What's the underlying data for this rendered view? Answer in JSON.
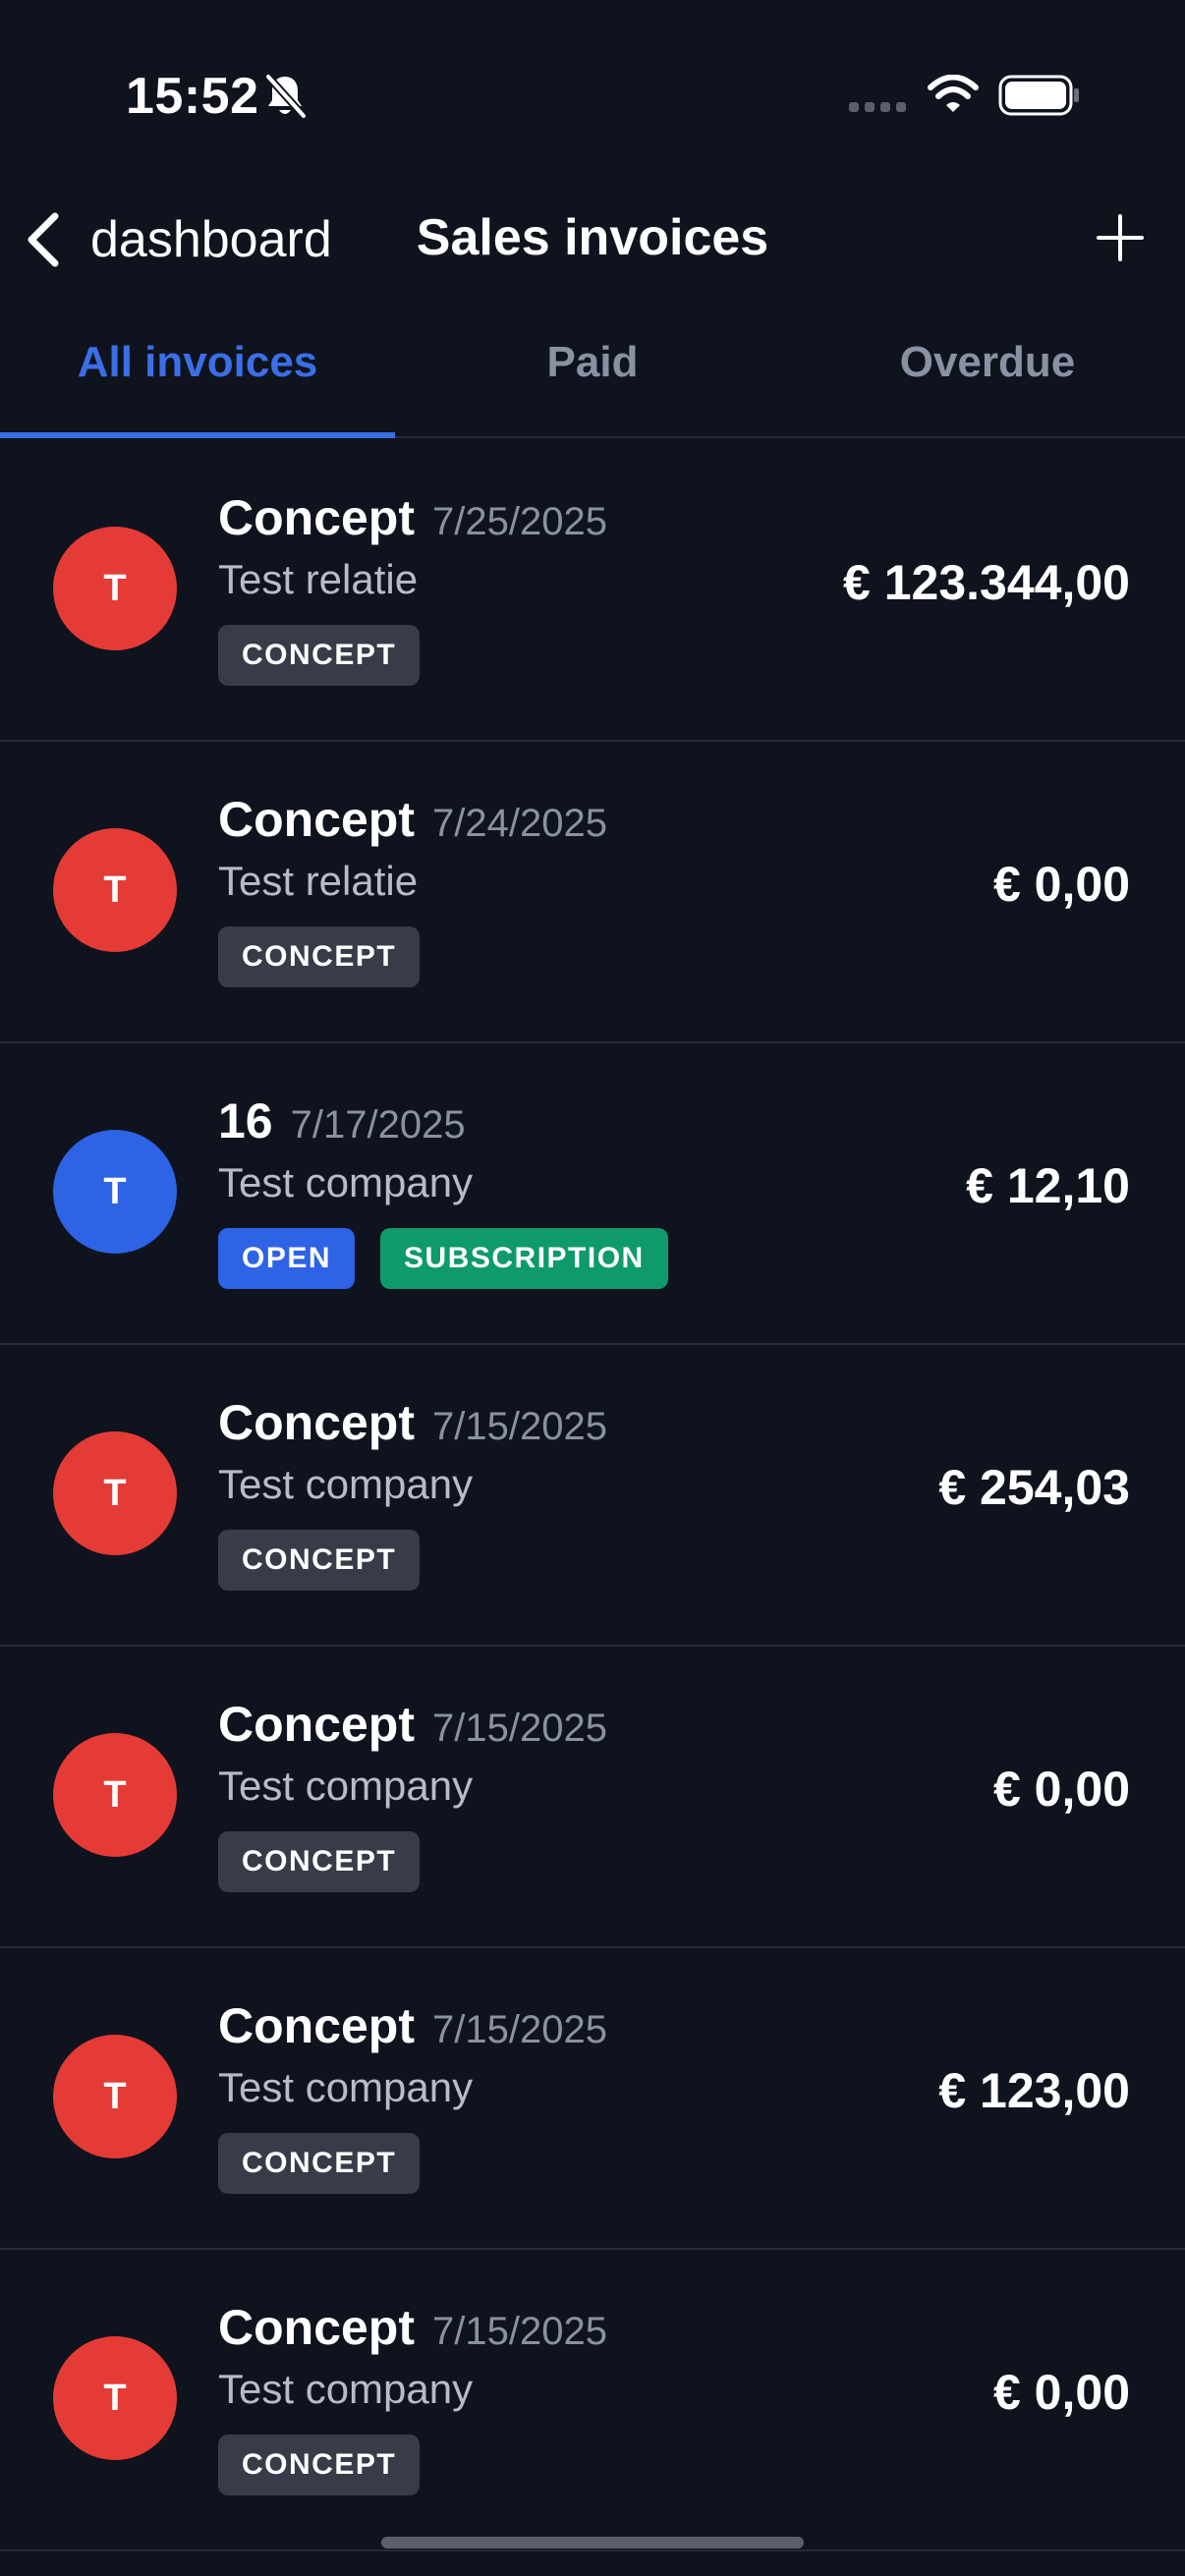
{
  "status_bar": {
    "time": "15:52",
    "icons": [
      "bell-muted-icon",
      "cellular-signal-icon",
      "wifi-icon",
      "battery-icon"
    ]
  },
  "nav": {
    "back_label": "dashboard",
    "title": "Sales invoices",
    "add_icon": "plus-icon"
  },
  "tabs": [
    {
      "label": "All invoices",
      "active": true
    },
    {
      "label": "Paid",
      "active": false
    },
    {
      "label": "Overdue",
      "active": false
    }
  ],
  "colors": {
    "background": "#0f131e",
    "accent": "#3b6fe8",
    "avatar_red": "#e53b37",
    "avatar_blue": "#2e63e6",
    "badge_concept": "#373c48",
    "badge_open": "#2e63e6",
    "badge_subscription": "#0f9a6b"
  },
  "invoices": [
    {
      "initial": "T",
      "avatar_color": "red",
      "number": "Concept",
      "date": "7/25/2025",
      "relation": "Test relatie",
      "badges": [
        {
          "label": "CONCEPT",
          "style": "gray"
        }
      ],
      "amount": "€ 123.344,00"
    },
    {
      "initial": "T",
      "avatar_color": "red",
      "number": "Concept",
      "date": "7/24/2025",
      "relation": "Test relatie",
      "badges": [
        {
          "label": "CONCEPT",
          "style": "gray"
        }
      ],
      "amount": "€ 0,00"
    },
    {
      "initial": "T",
      "avatar_color": "blue",
      "number": "16",
      "date": "7/17/2025",
      "relation": "Test company",
      "badges": [
        {
          "label": "OPEN",
          "style": "blue"
        },
        {
          "label": "SUBSCRIPTION",
          "style": "green"
        }
      ],
      "amount": "€ 12,10"
    },
    {
      "initial": "T",
      "avatar_color": "red",
      "number": "Concept",
      "date": "7/15/2025",
      "relation": "Test company",
      "badges": [
        {
          "label": "CONCEPT",
          "style": "gray"
        }
      ],
      "amount": "€ 254,03"
    },
    {
      "initial": "T",
      "avatar_color": "red",
      "number": "Concept",
      "date": "7/15/2025",
      "relation": "Test company",
      "badges": [
        {
          "label": "CONCEPT",
          "style": "gray"
        }
      ],
      "amount": "€ 0,00"
    },
    {
      "initial": "T",
      "avatar_color": "red",
      "number": "Concept",
      "date": "7/15/2025",
      "relation": "Test company",
      "badges": [
        {
          "label": "CONCEPT",
          "style": "gray"
        }
      ],
      "amount": "€ 123,00"
    },
    {
      "initial": "T",
      "avatar_color": "red",
      "number": "Concept",
      "date": "7/15/2025",
      "relation": "Test company",
      "badges": [
        {
          "label": "CONCEPT",
          "style": "gray"
        }
      ],
      "amount": "€ 0,00"
    }
  ]
}
